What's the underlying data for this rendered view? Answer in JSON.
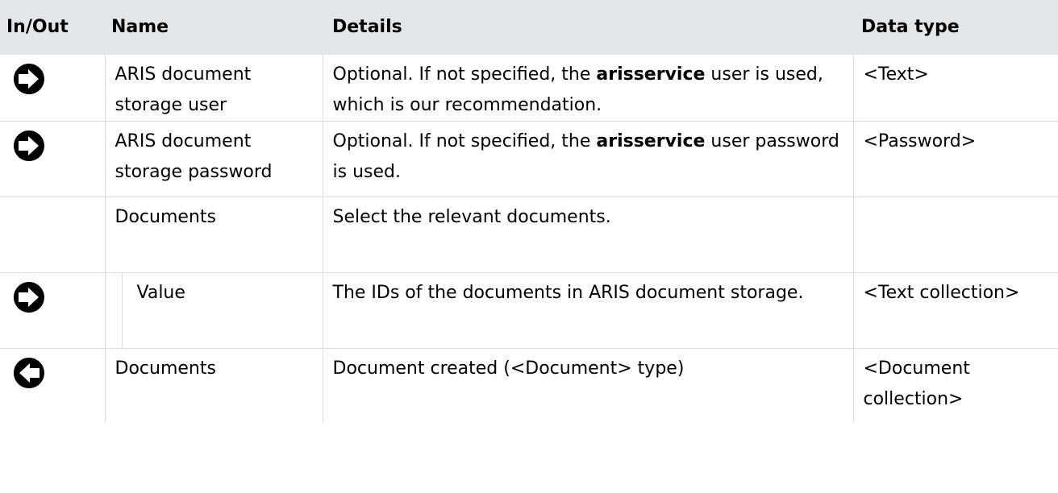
{
  "table": {
    "headers": {
      "in_out": "In/Out",
      "name": "Name",
      "details": "Details",
      "data_type": "Data type"
    },
    "rows": [
      {
        "direction_icon": "input-arrow-icon",
        "name": "ARIS document storage user",
        "details_before": "Optional. If not specified, the ",
        "details_bold": "arisservice",
        "details_after": " user is used, which is our recommendation.",
        "data_type": "<Text>"
      },
      {
        "direction_icon": "input-arrow-icon",
        "name": "ARIS document storage password",
        "details_before": "Optional. If not specified, the ",
        "details_bold": "arisservice",
        "details_after": " user password is used.",
        "data_type": "<Password>"
      },
      {
        "direction_icon": "",
        "name": "Documents",
        "details": "Select the relevant documents.",
        "data_type": ""
      },
      {
        "direction_icon": "input-arrow-icon",
        "name": "Value",
        "details": "The IDs of the documents in ARIS document storage.",
        "data_type": "<Text collection>"
      },
      {
        "direction_icon": "output-arrow-icon",
        "name": "Documents",
        "details": "Document created (<Document> type)",
        "data_type": "<Document collection>"
      }
    ]
  },
  "colors": {
    "header_background": "#e4e7ea",
    "grid_line": "#dcdfe2",
    "icon": "#000000"
  }
}
